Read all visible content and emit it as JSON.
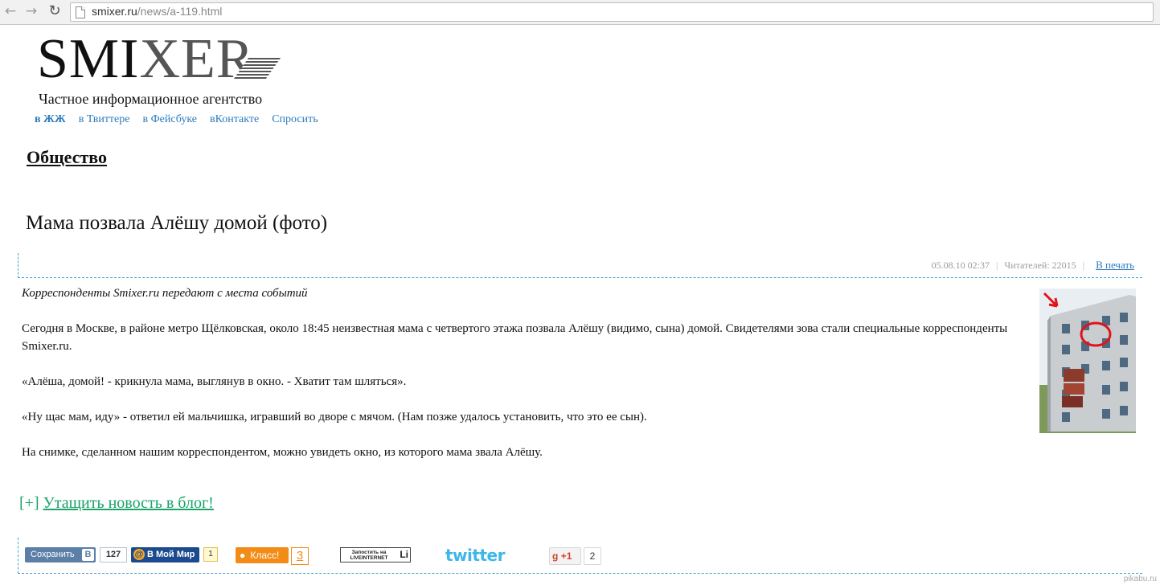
{
  "browser": {
    "url_host": "smixer.ru",
    "url_path": "/news/a-119.html",
    "back_icon": "arrow-left",
    "forward_icon": "arrow-right",
    "reload_icon": "reload"
  },
  "header": {
    "logo_smi": "SMI",
    "logo_xer": "XER",
    "tagline": "Частное информационное агентство",
    "links": [
      "в ЖЖ",
      "в Твиттере",
      "в Фейсбуке",
      "вКонтакте",
      "Спросить"
    ]
  },
  "section": "Общество",
  "article": {
    "title": "Мама позвала Алёшу домой (фото)",
    "date": "05.08.10 02:37",
    "readers": "Читателей: 22015",
    "print": "В печать",
    "lead": "Корреспонденты Smixer.ru передают с места событий",
    "paragraphs": [
      "Сегодня в Москве, в районе метро Щёлковская, около 18:45 неизвестная мама с четвертого этажа позвала Алёшу (видимо, сына) домой. Свидетелями зова стали специальные корреспонденты Smixer.ru.",
      "«Алёша, домой! - крикнула мама, выглянув в окно. - Хватит там шляться».",
      "«Ну щас мам, иду» - ответил ей мальчишка, игравший во дворе с мячом. (Нам позже удалось установить, что это ее сын).",
      "На снимке, сделанном нашим корреспондентом, можно увидеть окно, из которого мама звала Алёшу."
    ],
    "blog_prefix": "[+]",
    "blog_link": "Утащить новость в блог!"
  },
  "share": {
    "vk_label": "Сохранить",
    "vk_letter": "В",
    "vk_count": "127",
    "mm_label": "В Мой Мир",
    "mm_count": "1",
    "ok_label": "Класс!",
    "ok_count": "3",
    "li_label": "Запостить на LIVEINTERNET",
    "li_mark": "Li",
    "twitter_label": "twitter",
    "gplus_label": "+1",
    "gplus_count": "2"
  },
  "watermark": "pikabu.ru"
}
